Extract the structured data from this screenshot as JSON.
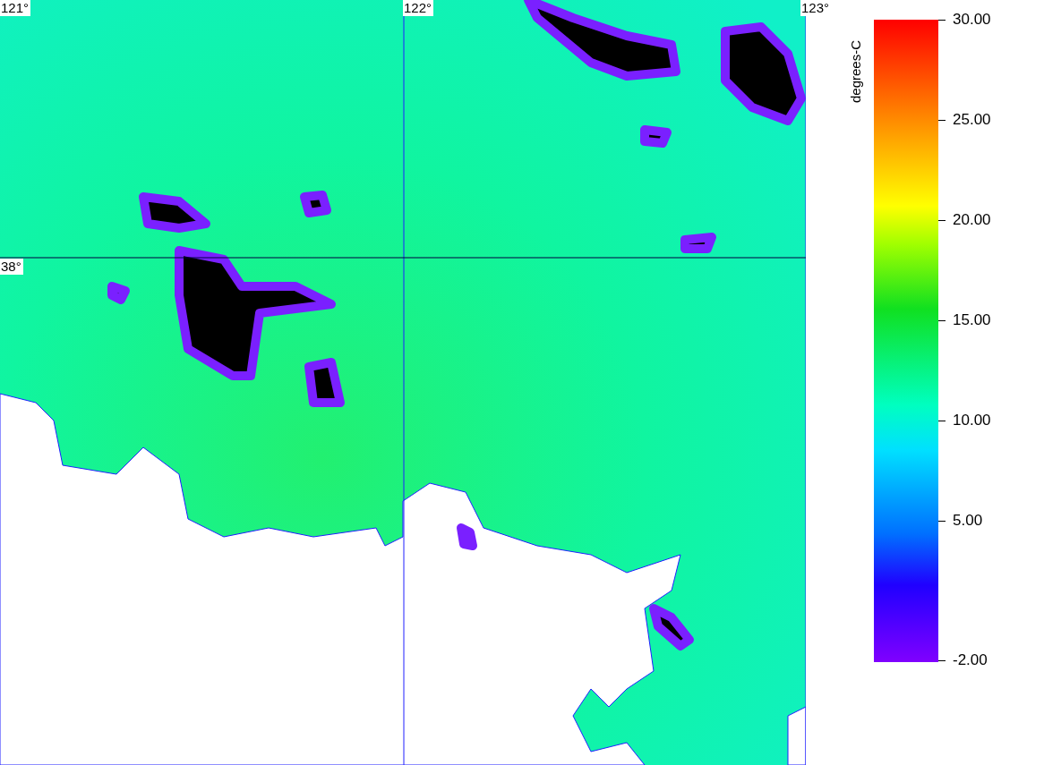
{
  "map": {
    "longitude_labels": [
      "121°",
      "122°",
      "123°"
    ],
    "latitude_labels": [
      "38°"
    ]
  },
  "legend": {
    "title": "degrees-C",
    "ticks": [
      "30.00",
      "25.00",
      "20.00",
      "15.00",
      "10.00",
      "5.00",
      "-2.00"
    ]
  }
}
